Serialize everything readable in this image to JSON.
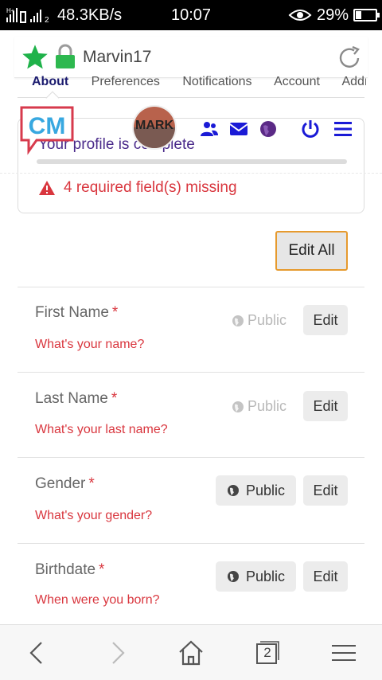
{
  "status_bar": {
    "network_type": "H+",
    "net_speed": "48.3KB/s",
    "time": "10:07",
    "battery_percent": "29%",
    "battery_level": 0.29,
    "sim2_label": "2"
  },
  "browser": {
    "url_text": "Marvin17",
    "star_color": "#1fb24a",
    "lock_color": "#2db84f"
  },
  "page": {
    "tabs": [
      "About",
      "Preferences",
      "Notifications",
      "Account",
      "Addresses"
    ],
    "cm_logo_text": "CM",
    "avatar_text": "MARK",
    "profile_text": "Your profile is     complete",
    "profile_progress": 0.0,
    "warning_text": "4 required field(s) missing",
    "edit_all_label": "Edit All",
    "fields": [
      {
        "label": "First Name",
        "required": "*",
        "hint": "What's your name?",
        "visibility": "Public",
        "edit": "Edit"
      },
      {
        "label": "Last Name",
        "required": "*",
        "hint": "What's your last name?",
        "visibility": "Public",
        "edit": "Edit"
      },
      {
        "label": "Gender",
        "required": "*",
        "hint": "What's your gender?",
        "visibility": "Public",
        "edit": "Edit"
      },
      {
        "label": "Birthdate",
        "required": "*",
        "hint": "When were you born?",
        "visibility": "Public",
        "edit": "Edit"
      }
    ]
  },
  "bottom_bar": {
    "tab_count": "2",
    "icons": [
      "back-icon",
      "forward-icon",
      "home-icon",
      "tabs-icon",
      "menu-icon"
    ]
  },
  "colors": {
    "accent_red": "#d9363e",
    "nav_blue": "#1a1ad6",
    "nav_purple": "#5b2a86",
    "edit_all_border": "#e69a2e"
  }
}
